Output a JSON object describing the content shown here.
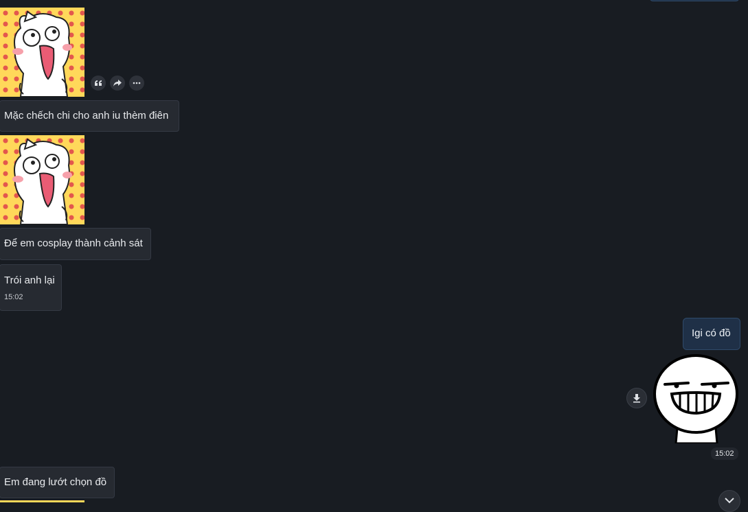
{
  "messages": {
    "m1_text": "Mặc chếch chi cho anh iu thèm điên",
    "m2_text": "Để em cosplay thành cảnh sát",
    "m3_text": "Trói anh lại",
    "m3_time": "15:02",
    "out1_text": "Igi có đồ",
    "out_sticker_time": "15:02",
    "m4_text": "Em đang lướt chọn đồ"
  },
  "icons": {
    "quote": "quote-icon",
    "forward": "forward-icon",
    "more": "more-icon",
    "download": "download-icon",
    "scroll_down": "chevron-down-icon"
  },
  "colors": {
    "background": "#181c22",
    "incoming_bubble": "#262a31",
    "outgoing_bubble": "#1f3047"
  }
}
